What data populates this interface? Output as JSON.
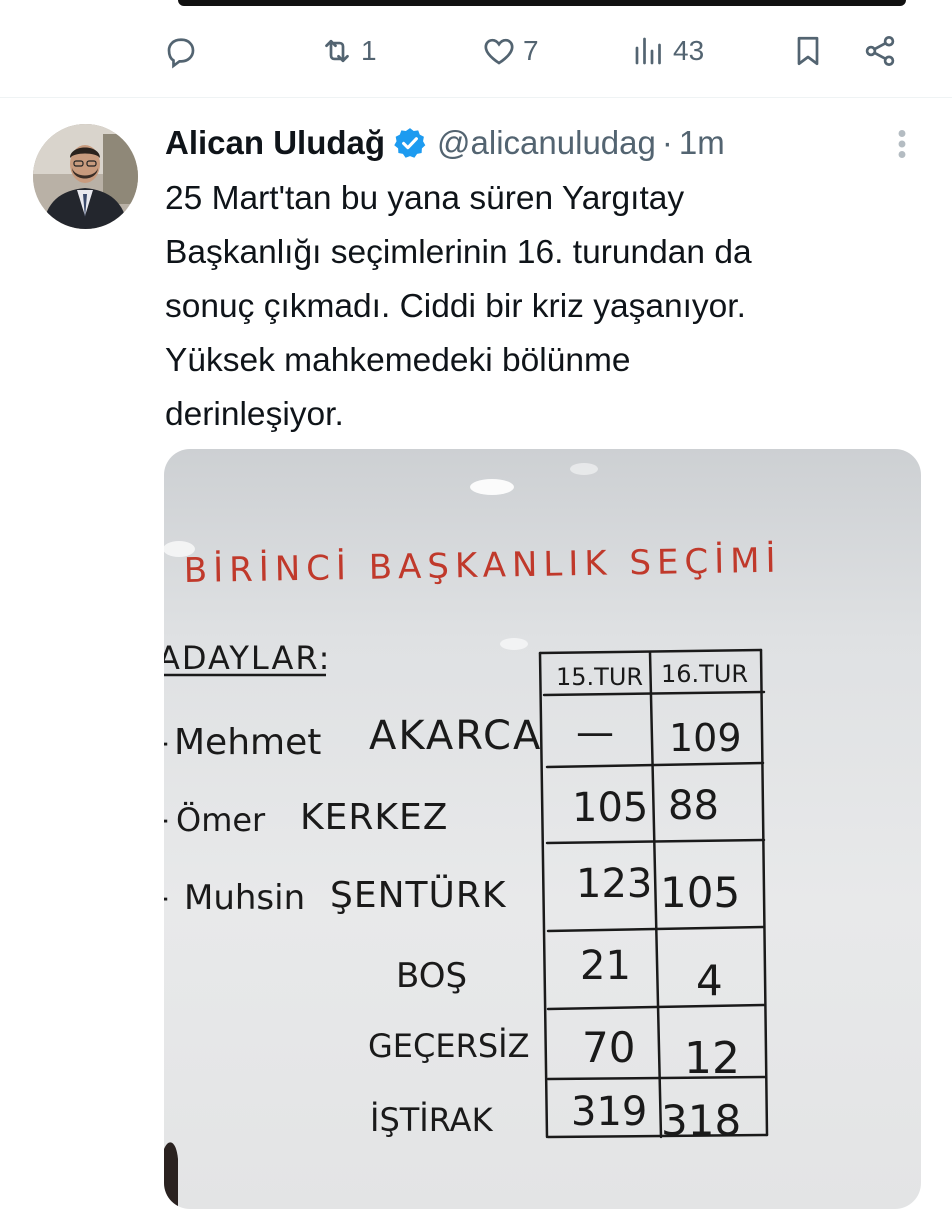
{
  "previous_tweet": {
    "actions": {
      "retweets": "1",
      "likes": "7",
      "views": "43"
    }
  },
  "tweet": {
    "author_name": "Alican Uludağ",
    "handle": "@alicanuludag",
    "separator": "·",
    "time": "1m",
    "text": "25 Mart'tan bu yana süren Yargıtay\nBaşkanlığı seçimlerinin 16. turundan da\nsonuç çıkmadı. Ciddi bir kriz yaşanıyor.\nYüksek mahkemedeki bölünme\nderinleşiyor.",
    "verified_color": "#1d9bf0"
  },
  "whiteboard": {
    "title": "BİRİNCİ BAŞKANLIK SEÇİMİ",
    "candidates_label": "ADAYLAR:",
    "columns": [
      "15.TUR",
      "16.TUR"
    ],
    "rows": [
      {
        "prefix": "-",
        "first": "Mehmet",
        "last": "AKARCA",
        "r15": "—",
        "r16": "109"
      },
      {
        "prefix": "-",
        "first": "Ömer",
        "last": "KERKEZ",
        "r15": "105",
        "r16": "88"
      },
      {
        "prefix": "-",
        "first": "Muhsin",
        "last": "ŞENTÜRK",
        "r15": "123",
        "r16": "105"
      },
      {
        "prefix": "",
        "first": "",
        "last": "BOŞ",
        "r15": "21",
        "r16": "4"
      },
      {
        "prefix": "",
        "first": "",
        "last": "GEÇERSİZ",
        "r15": "70",
        "r16": "12"
      },
      {
        "prefix": "",
        "first": "",
        "last": "İŞTİRAK",
        "r15": "319",
        "r16": "318"
      }
    ],
    "title_color": "#c0392b",
    "ink_color": "#1a1a1a"
  },
  "icons": {
    "reply": "reply-icon",
    "retweet": "retweet-icon",
    "like": "heart-icon",
    "views": "views-icon",
    "bookmark": "bookmark-icon",
    "share": "share-icon",
    "verified": "verified-badge-icon",
    "more": "more-icon"
  }
}
